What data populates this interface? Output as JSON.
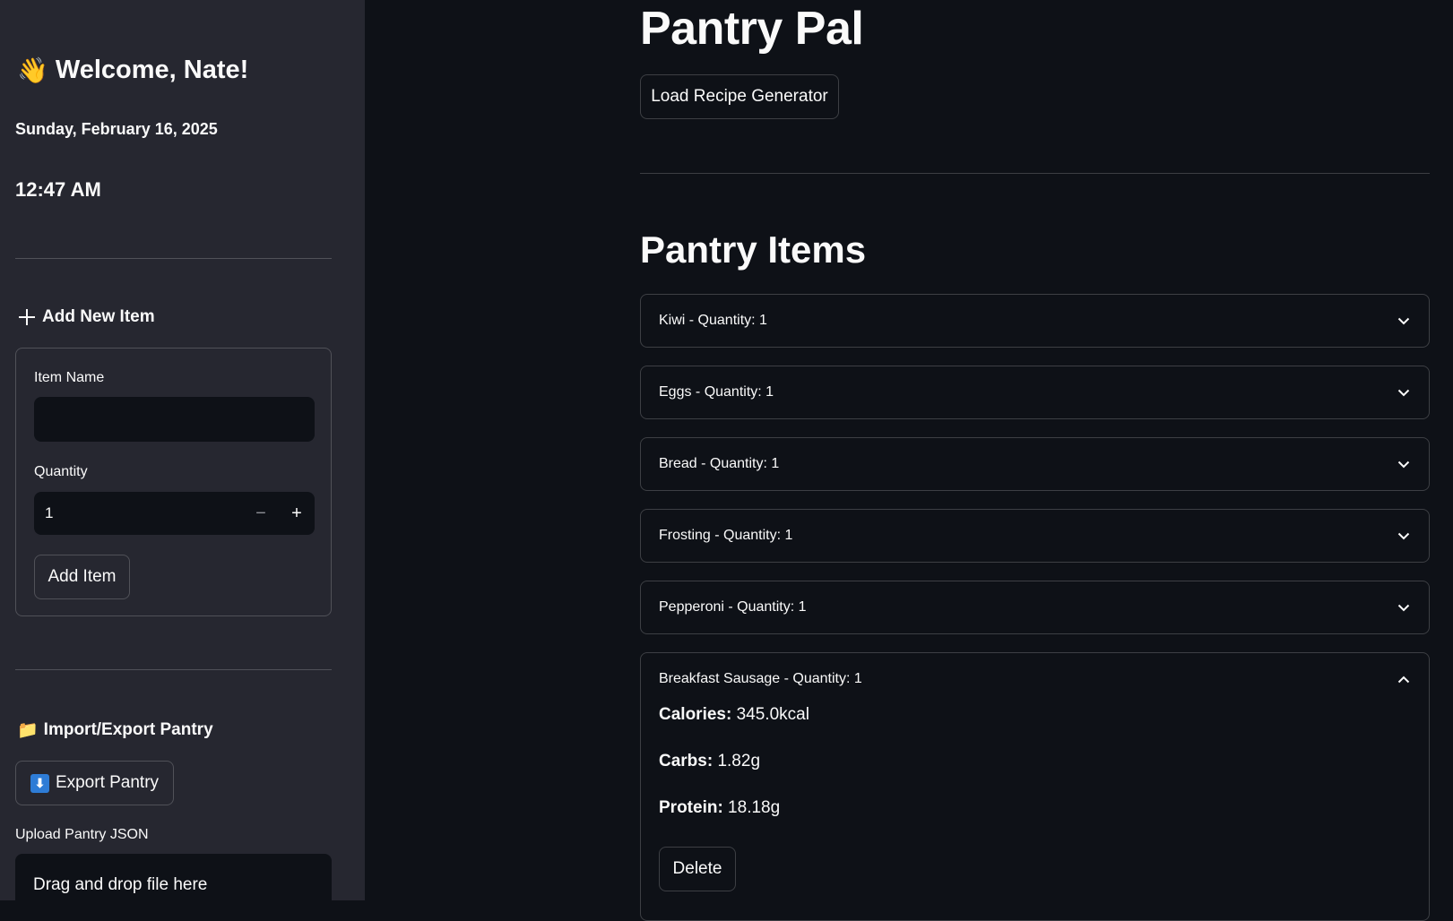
{
  "sidebar": {
    "welcome": "Welcome, Nate!",
    "wave_icon": "👋",
    "date": "Sunday, February 16, 2025",
    "time": "12:47 AM",
    "add_section": {
      "title": "Add New Item",
      "icon": "plus-icon",
      "item_name_label": "Item Name",
      "item_name_value": "",
      "quantity_label": "Quantity",
      "quantity_value": "1",
      "minus": "−",
      "plus": "+",
      "add_button": "Add Item"
    },
    "import_section": {
      "title": "Import/Export Pantry",
      "folder_icon": "📁",
      "export_button": "Export Pantry",
      "export_icon": "⬇",
      "upload_label": "Upload Pantry JSON",
      "dropzone_text": "Drag and drop file here"
    }
  },
  "main": {
    "title": "Pantry Pal",
    "load_button": "Load Recipe Generator",
    "section_title": "Pantry Items",
    "items": [
      {
        "label": "Kiwi - Quantity: 1",
        "expanded": false
      },
      {
        "label": "Eggs - Quantity: 1",
        "expanded": false
      },
      {
        "label": "Bread - Quantity: 1",
        "expanded": false
      },
      {
        "label": "Frosting - Quantity: 1",
        "expanded": false
      },
      {
        "label": "Pepperoni - Quantity: 1",
        "expanded": false
      },
      {
        "label": "Breakfast Sausage - Quantity: 1",
        "expanded": true,
        "details": {
          "calories_label": "Calories:",
          "calories_value": " 345.0kcal",
          "carbs_label": "Carbs:",
          "carbs_value": " 1.82g",
          "protein_label": "Protein:",
          "protein_value": " 18.18g",
          "delete_button": "Delete"
        }
      }
    ]
  },
  "colors": {
    "app_bg": "#0e1117",
    "sidebar_bg": "#262730",
    "text": "#fafafa",
    "border": "rgba(250,250,250,0.2)",
    "export_icon_bg": "#2e7cd6"
  }
}
